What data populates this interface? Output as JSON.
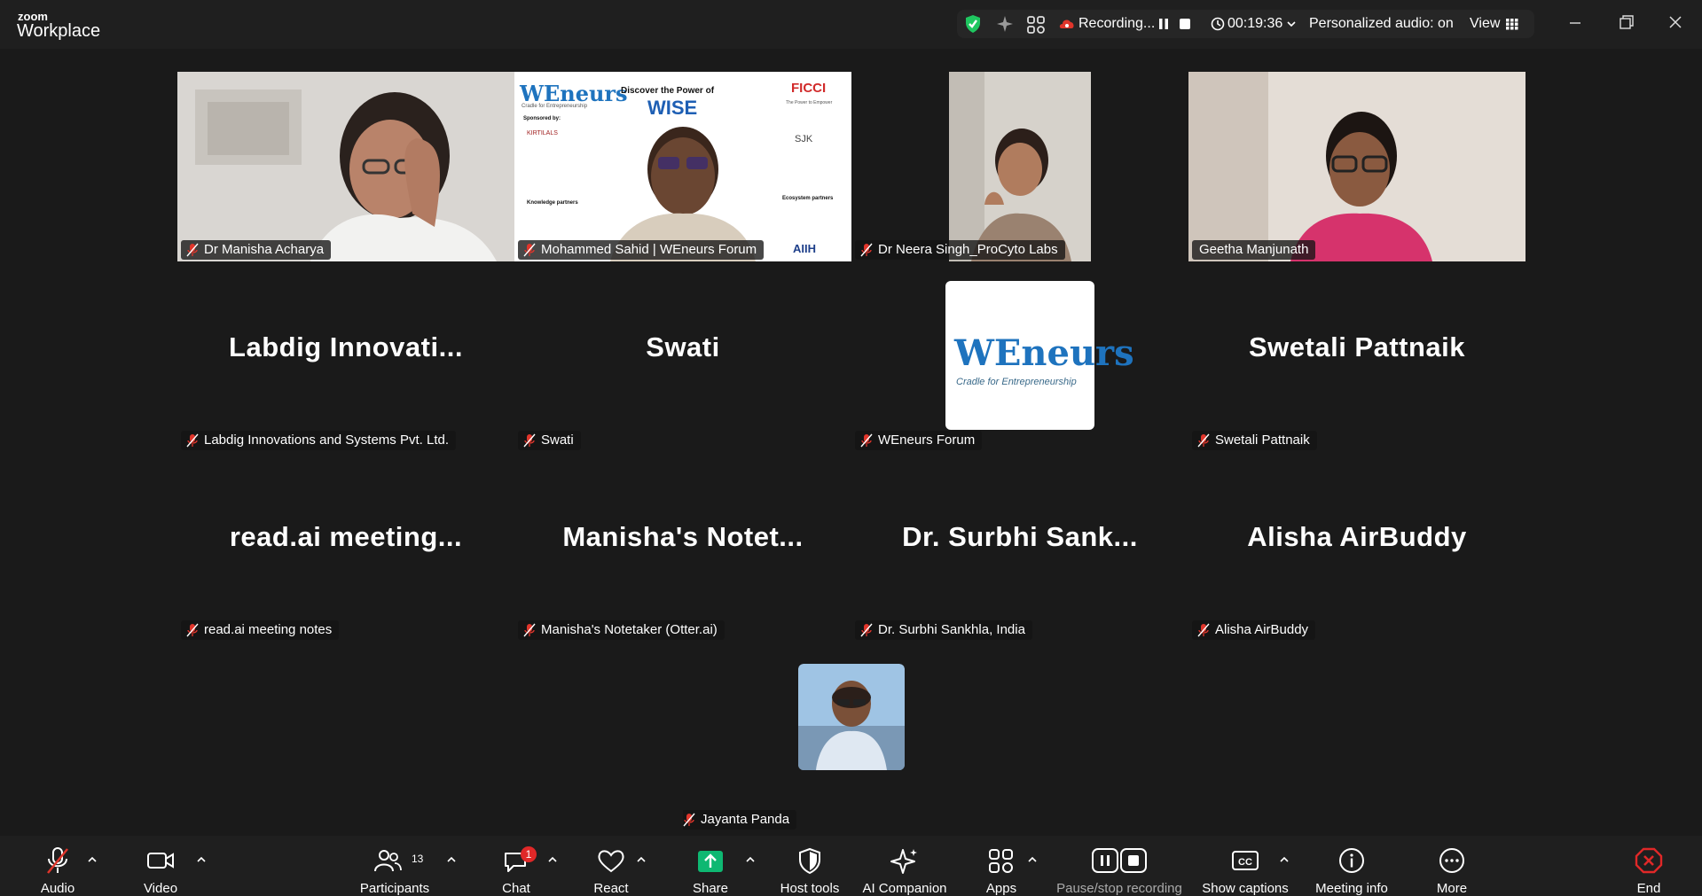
{
  "app": {
    "brand_small": "zoom",
    "brand_name": "Workplace"
  },
  "status_bar": {
    "recording_label": "Recording...",
    "timer": "00:19:36",
    "audio_label": "Personalized audio: on",
    "view_label": "View"
  },
  "participants": [
    {
      "name": "Dr Manisha Acharya",
      "video": true
    },
    {
      "name": "Mohammed Sahid | WEneurs Forum",
      "video": true,
      "slide": {
        "heading": "Discover the Power of",
        "logo_text": "WISE",
        "brand": "WEneurs",
        "tagline": "Cradle for Entrepreneurship",
        "sponsored": "Sponsored by:",
        "sponsor_left": "KIRTILALS",
        "knowledge": "Knowledge partners",
        "ficci": "FICCI",
        "ficci_sub": "The Power to Empower",
        "sponsor_right": "SJK",
        "ecosystem": "Ecosystem partners",
        "aiih": "AIIH"
      }
    },
    {
      "name": "Dr Neera Singh_ProCyto Labs",
      "video": true
    },
    {
      "name": "Geetha Manjunath",
      "video": true,
      "active_speaker": true
    },
    {
      "name": "Labdig Innovations and Systems Pvt. Ltd.",
      "display": "Labdig  Innovati..."
    },
    {
      "name": "Swati",
      "display": "Swati"
    },
    {
      "name": "WEneurs Forum",
      "logo_brand": "WEneurs",
      "logo_tagline": "Cradle for Entrepreneurship"
    },
    {
      "name": "Swetali Pattnaik",
      "display": "Swetali Pattnaik"
    },
    {
      "name": "read.ai meeting notes",
      "display": "read.ai  meeting..."
    },
    {
      "name": "Manisha's Notetaker (Otter.ai)",
      "display": "Manisha's  Notet..."
    },
    {
      "name": "Dr. Surbhi Sankhla, India",
      "display": "Dr. Surbhi Sank..."
    },
    {
      "name": "Alisha AirBuddy",
      "display": "Alisha AirBuddy"
    },
    {
      "name": "Jayanta Panda",
      "video": true
    }
  ],
  "toolbar": {
    "audio": "Audio",
    "video": "Video",
    "participants": "Participants",
    "participants_count": "13",
    "chat": "Chat",
    "chat_badge": "1",
    "react": "React",
    "share": "Share",
    "host_tools": "Host tools",
    "ai_companion": "AI Companion",
    "apps": "Apps",
    "pause_stop": "Pause/stop recording",
    "captions": "Show captions",
    "meeting_info": "Meeting info",
    "more": "More",
    "end": "End"
  },
  "colors": {
    "accent_green": "#2ed67c",
    "end_red": "#e02828",
    "share_green": "#0eb872",
    "mute_red": "#e0352b"
  }
}
